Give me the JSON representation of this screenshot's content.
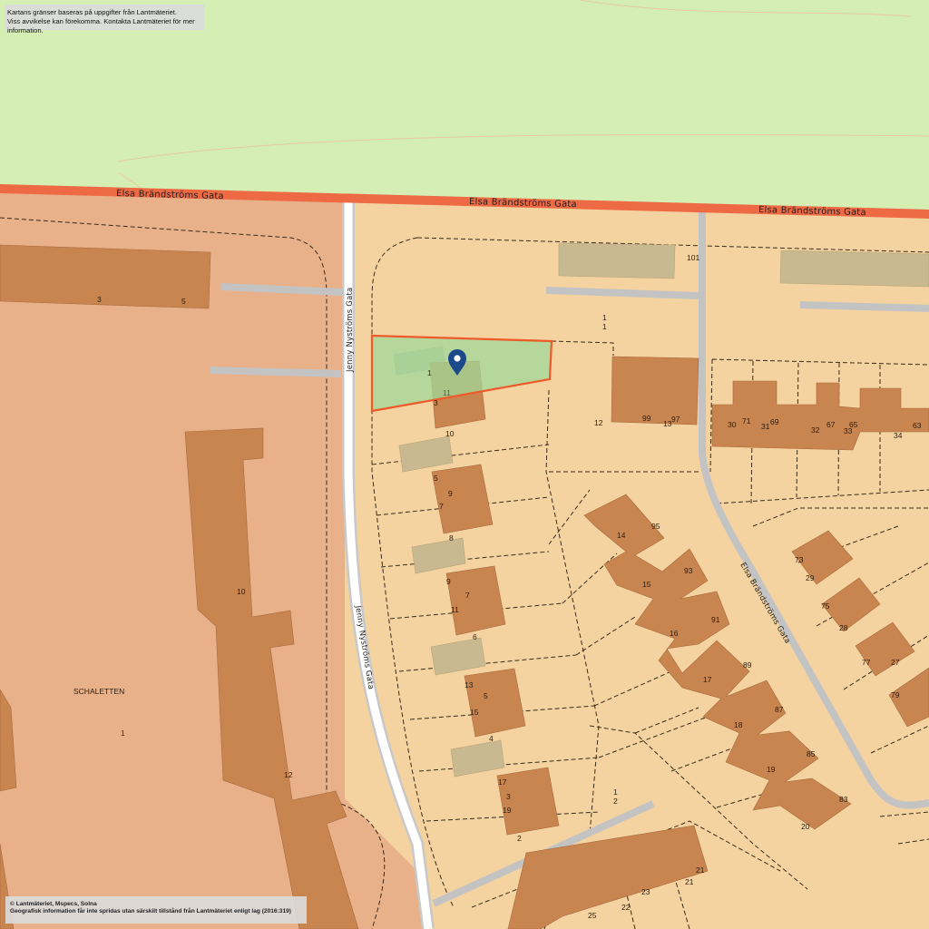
{
  "notices": {
    "top_line1": "Kartans gränser baseras på uppgifter från Lantmäteriet.",
    "top_line2": "Viss avvikelse kan förekomma. Kontakta Lantmäteriet för mer information.",
    "bottom_line1": "© Lantmäteriet, Mspecs, Solna",
    "bottom_line2": "Geografisk information får inte spridas utan särskilt tillstånd från Lantmäteriet enligt lag (2016:319)"
  },
  "roads": {
    "main_north": "Elsa Brändströms Gata",
    "west": "Jenny Nyströms Gata",
    "east_curve": "Elsa Brändströms Gata"
  },
  "areas": {
    "west_name": "SCHALETTEN"
  },
  "labels": {
    "w3": "3",
    "w5": "5",
    "w10": "10",
    "w1": "1",
    "w12": "12",
    "n101": "101",
    "n1a": "1",
    "n1b": "1",
    "p1": "1",
    "p11": "11",
    "p3": "3",
    "p10": "10",
    "p5": "5",
    "p9": "9",
    "p7": "7",
    "p8": "8",
    "q9": "9",
    "q7": "7",
    "q11": "11",
    "q6": "6",
    "r13": "13",
    "r5": "5",
    "r15": "15",
    "r4": "4",
    "s17": "17",
    "s3": "3",
    "s19": "19",
    "s2": "2",
    "c12": "12",
    "c99": "99",
    "c13": "13",
    "c97": "97",
    "c1a": "1",
    "c2": "2",
    "e30": "30",
    "e71": "71",
    "e31": "31",
    "e69": "69",
    "e32": "32",
    "e67": "67",
    "e33": "33",
    "e65": "65",
    "e34": "34",
    "e63": "63",
    "d14": "14",
    "d95": "95",
    "d15": "15",
    "d93": "93",
    "d16": "16",
    "d91": "91",
    "d17": "17",
    "d89": "89",
    "d18": "18",
    "d87": "87",
    "d19": "19",
    "d85": "85",
    "d20": "20",
    "d83": "83",
    "f73": "73",
    "f29": "29",
    "f75": "75",
    "f28": "28",
    "f77": "77",
    "f27": "27",
    "f79": "79",
    "g21a": "21",
    "g21b": "21",
    "g23": "23",
    "g22": "22",
    "g25": "25"
  },
  "colors": {
    "park": "#d5eeb4",
    "residential_west": "#e8b18a",
    "residential_east": "#f5d3a0",
    "building": "#c98550",
    "garage": "#c8b990",
    "main_road": "#ee6a44",
    "selection_fill": "#9fd89a",
    "selection_stroke": "#ef5a2a",
    "pin": "#1b4a8a"
  },
  "icons": {
    "pin": "map-pin-icon"
  }
}
